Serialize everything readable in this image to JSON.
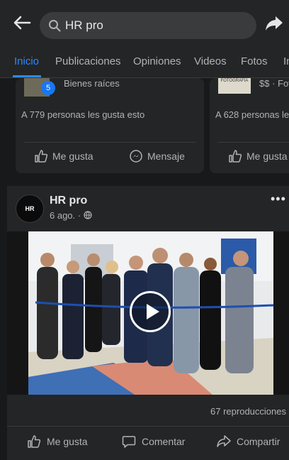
{
  "header": {
    "search_value": "HR pro",
    "back_icon": "arrow-left-icon",
    "share_icon": "share-arrow-icon"
  },
  "tabs": [
    {
      "label": "Inicio",
      "active": true
    },
    {
      "label": "Publicaciones",
      "active": false
    },
    {
      "label": "Opiniones",
      "active": false
    },
    {
      "label": "Videos",
      "active": false
    },
    {
      "label": "Fotos",
      "active": false
    },
    {
      "label": "In",
      "active": false
    }
  ],
  "cards": [
    {
      "badge": "5",
      "category": "Bienes raíces",
      "likes": "A 779 personas les gusta esto",
      "like_label": "Me gusta",
      "message_label": "Mensaje"
    },
    {
      "thumb_text": "FOTOGRAFIA",
      "category": "$$ · Fotó",
      "likes": "A 628 personas les",
      "like_label": "Me gusta"
    }
  ],
  "post": {
    "avatar_text": "HR",
    "name": "HR pro",
    "date": "6 ago. · ",
    "views": "67 reproducciones",
    "like_label": "Me gusta",
    "comment_label": "Comentar",
    "share_label": "Compartir"
  },
  "colors": {
    "accent": "#2d88ff",
    "background": "#18191a",
    "surface": "#242526"
  }
}
